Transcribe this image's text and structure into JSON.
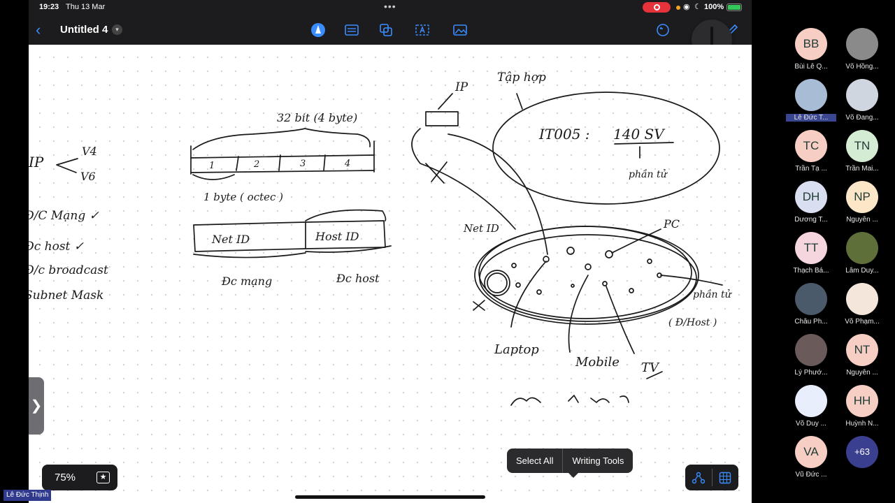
{
  "status_bar": {
    "time": "19:23",
    "date": "Thu 13 Mar",
    "battery": "100%"
  },
  "toolbar": {
    "document_title": "Untitled 4"
  },
  "popup_menu": {
    "select_all": "Select All",
    "writing_tools": "Writing Tools"
  },
  "zoom": {
    "level": "75%"
  },
  "self_view": {
    "name": "Lê Đức Thịnh"
  },
  "participants": [
    {
      "initials": "BB",
      "name": "Bùi Lê Q...",
      "color": "#f7cec4"
    },
    {
      "initials": "",
      "name": "Võ Hồng...",
      "color": "#8a8a8a"
    },
    {
      "initials": "",
      "name": "Lê Đức T...",
      "color": "#a9bcd6"
    },
    {
      "initials": "",
      "name": "Võ Đang...",
      "color": "#cfd6e0"
    },
    {
      "initials": "TC",
      "name": "Trần Tạ ...",
      "color": "#f7cec4"
    },
    {
      "initials": "TN",
      "name": "Trần Mai...",
      "color": "#d4ebd4"
    },
    {
      "initials": "DH",
      "name": "Dương T...",
      "color": "#d9dff0"
    },
    {
      "initials": "NP",
      "name": "Nguyễn ...",
      "color": "#fbe6c8"
    },
    {
      "initials": "TT",
      "name": "Thạch Bá...",
      "color": "#f5d6de"
    },
    {
      "initials": "",
      "name": "Lâm Duy...",
      "color": "#5f6f3a"
    },
    {
      "initials": "",
      "name": "Châu Ph...",
      "color": "#4a5a6a"
    },
    {
      "initials": "",
      "name": "Võ Phạm...",
      "color": "#f4e6da"
    },
    {
      "initials": "",
      "name": "Lý Phướ...",
      "color": "#6a5a5a"
    },
    {
      "initials": "NT",
      "name": "Nguyễn ...",
      "color": "#f7cec4"
    },
    {
      "initials": "",
      "name": "Võ Duy ...",
      "color": "#e8eefc"
    },
    {
      "initials": "HH",
      "name": "Huỳnh N...",
      "color": "#f7cec4"
    },
    {
      "initials": "VA",
      "name": "Vũ Đức ...",
      "color": "#f7cec4"
    },
    {
      "initials": "+63",
      "name": "",
      "color": "#3b3f8f"
    }
  ],
  "handwriting": {
    "bits": "32 bit (4 byte)",
    "o1": "1",
    "o2": "2",
    "o3": "3",
    "o4": "4",
    "byte": "1 byte ( octec )",
    "netid": "Net ID",
    "hostid": "Host ID",
    "dc_may": "Đc mạng",
    "dc_host": "Đc host",
    "ip": "IP",
    "v4": "V4",
    "v6": "V6",
    "list1": "Đ/C Mạng ✓",
    "list2": "Đc host ✓",
    "list3": "Đ/c broadcast",
    "list4": "Subnet Mask",
    "tap_hop": "Tập hợp",
    "ip2": "IP",
    "it005": "IT005 :",
    "sv": "140 SV",
    "phan_tu": "phần tử",
    "netid2": "Net ID",
    "pc": "PC",
    "phan_tu2": "phần tử",
    "dhost": "( Đ/Host )",
    "laptop": "Laptop",
    "mobile": "Mobile",
    "tv": "TV"
  }
}
